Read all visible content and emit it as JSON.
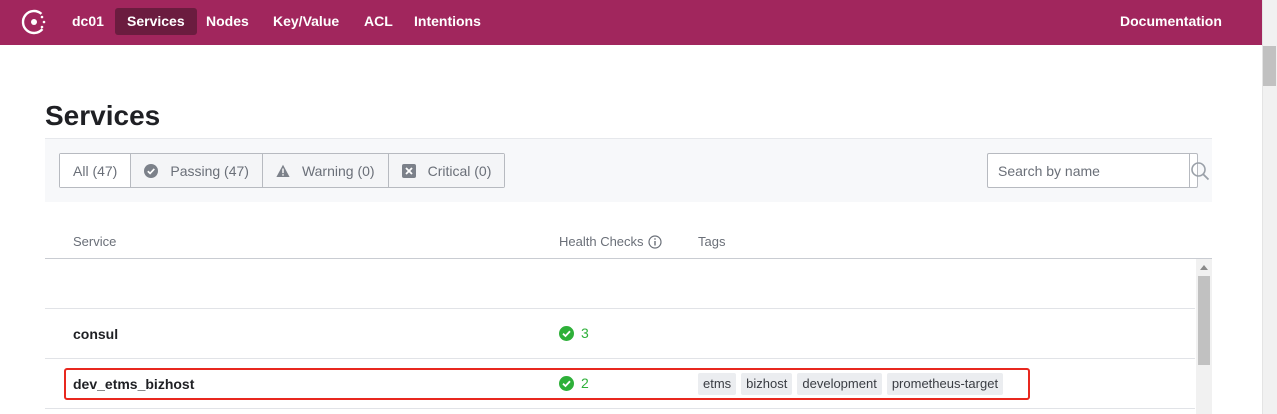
{
  "nav": {
    "datacenter": "dc01",
    "items": [
      {
        "label": "Services",
        "active": true
      },
      {
        "label": "Nodes",
        "active": false
      },
      {
        "label": "Key/Value",
        "active": false
      },
      {
        "label": "ACL",
        "active": false
      },
      {
        "label": "Intentions",
        "active": false
      }
    ],
    "documentation": "Documentation",
    "brand_color": "#a1265d",
    "active_color": "#6b1c3f"
  },
  "page": {
    "title": "Services"
  },
  "filters": [
    {
      "label": "All (47)",
      "icon": "none",
      "active": true
    },
    {
      "label": "Passing (47)",
      "icon": "check-circle-icon",
      "active": false
    },
    {
      "label": "Warning (0)",
      "icon": "warning-triangle-icon",
      "active": false
    },
    {
      "label": "Critical (0)",
      "icon": "critical-x-icon",
      "active": false
    }
  ],
  "search": {
    "placeholder": "Search by name",
    "value": ""
  },
  "table": {
    "headers": {
      "service": "Service",
      "health": "Health Checks",
      "tags": "Tags"
    },
    "rows": [
      {
        "name": "",
        "health": "",
        "tags": []
      },
      {
        "name": "consul",
        "health": "3",
        "tags": []
      },
      {
        "name": "dev_etms_bizhost",
        "health": "2",
        "tags": [
          "etms",
          "bizhost",
          "development",
          "prometheus-target"
        ]
      }
    ]
  },
  "colors": {
    "passing": "#2eb039",
    "highlight": "#e8281f"
  }
}
